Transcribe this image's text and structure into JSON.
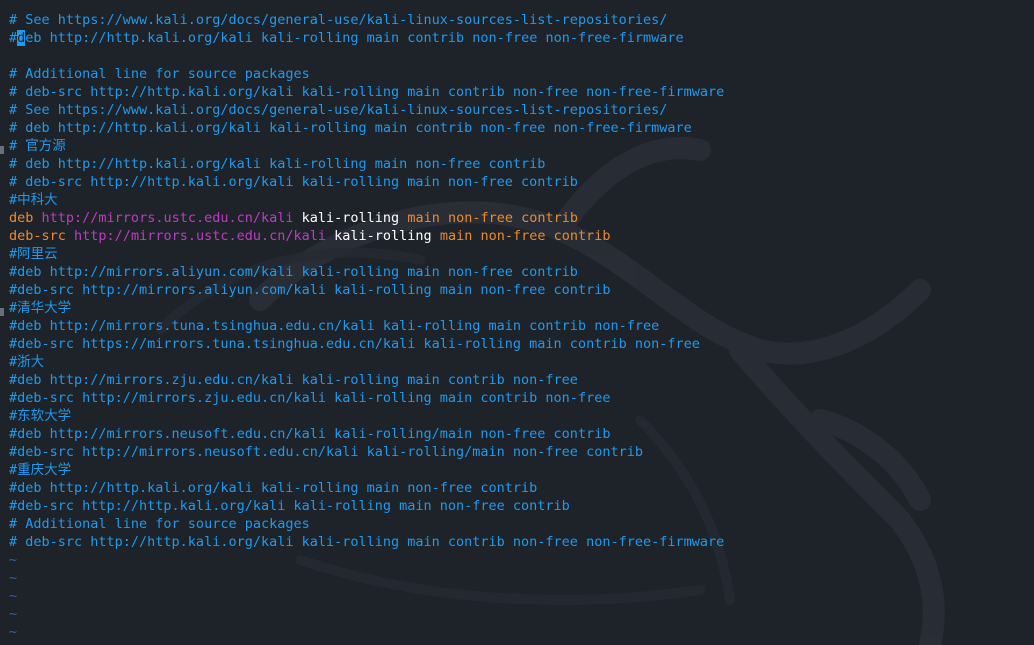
{
  "editor": {
    "lines": [
      {
        "kind": "comment",
        "text": "# See https://www.kali.org/docs/general-use/kali-linux-sources-list-repositories/"
      },
      {
        "kind": "cursor",
        "before": "#",
        "cursor_char": "d",
        "after": "eb http://http.kali.org/kali kali-rolling main contrib non-free non-free-firmware"
      },
      {
        "kind": "blank",
        "text": ""
      },
      {
        "kind": "comment",
        "text": "# Additional line for source packages"
      },
      {
        "kind": "comment",
        "text": "# deb-src http://http.kali.org/kali kali-rolling main contrib non-free non-free-firmware"
      },
      {
        "kind": "comment",
        "text": "# See https://www.kali.org/docs/general-use/kali-linux-sources-list-repositories/"
      },
      {
        "kind": "comment",
        "text": "# deb http://http.kali.org/kali kali-rolling main contrib non-free non-free-firmware"
      },
      {
        "kind": "comment",
        "text": "# 官方源"
      },
      {
        "kind": "comment",
        "text": "# deb http://http.kali.org/kali kali-rolling main non-free contrib"
      },
      {
        "kind": "comment",
        "text": "# deb-src http://http.kali.org/kali kali-rolling main non-free contrib"
      },
      {
        "kind": "comment",
        "text": "#中科大"
      },
      {
        "kind": "entry",
        "type": "deb",
        "url": "http://mirrors.ustc.edu.cn/kali",
        "dist": "kali-rolling",
        "components": "main non-free contrib"
      },
      {
        "kind": "entry",
        "type": "deb-src",
        "url": "http://mirrors.ustc.edu.cn/kali",
        "dist": "kali-rolling",
        "components": "main non-free contrib"
      },
      {
        "kind": "comment",
        "text": "#阿里云"
      },
      {
        "kind": "comment",
        "text": "#deb http://mirrors.aliyun.com/kali kali-rolling main non-free contrib"
      },
      {
        "kind": "comment",
        "text": "#deb-src http://mirrors.aliyun.com/kali kali-rolling main non-free contrib"
      },
      {
        "kind": "comment",
        "text": "#清华大学"
      },
      {
        "kind": "comment",
        "text": "#deb http://mirrors.tuna.tsinghua.edu.cn/kali kali-rolling main contrib non-free"
      },
      {
        "kind": "comment",
        "text": "#deb-src https://mirrors.tuna.tsinghua.edu.cn/kali kali-rolling main contrib non-free"
      },
      {
        "kind": "comment",
        "text": "#浙大"
      },
      {
        "kind": "comment",
        "text": "#deb http://mirrors.zju.edu.cn/kali kali-rolling main contrib non-free"
      },
      {
        "kind": "comment",
        "text": "#deb-src http://mirrors.zju.edu.cn/kali kali-rolling main contrib non-free"
      },
      {
        "kind": "comment",
        "text": "#东软大学"
      },
      {
        "kind": "comment",
        "text": "#deb http://mirrors.neusoft.edu.cn/kali kali-rolling/main non-free contrib"
      },
      {
        "kind": "comment",
        "text": "#deb-src http://mirrors.neusoft.edu.cn/kali kali-rolling/main non-free contrib"
      },
      {
        "kind": "comment",
        "text": "#重庆大学"
      },
      {
        "kind": "comment",
        "text": "#deb http://http.kali.org/kali kali-rolling main non-free contrib"
      },
      {
        "kind": "comment",
        "text": "#deb-src http://http.kali.org/kali kali-rolling main non-free contrib"
      },
      {
        "kind": "comment",
        "text": "# Additional line for source packages"
      },
      {
        "kind": "comment",
        "text": "# deb-src http://http.kali.org/kali kali-rolling main contrib non-free non-free-firmware"
      },
      {
        "kind": "tilde",
        "text": "~"
      },
      {
        "kind": "tilde",
        "text": "~"
      },
      {
        "kind": "tilde",
        "text": "~"
      },
      {
        "kind": "tilde",
        "text": "~"
      },
      {
        "kind": "tilde",
        "text": "~"
      }
    ]
  },
  "colors": {
    "background": "#1e2229",
    "comment": "#1d9bf0",
    "keyword": "#ef8a2a",
    "url": "#c03bc4",
    "distribution": "#ffffff",
    "tilde": "#3b5bb5",
    "cursor": "#1d9bf0"
  },
  "background_art": "kali-dragon-watermark-icon"
}
